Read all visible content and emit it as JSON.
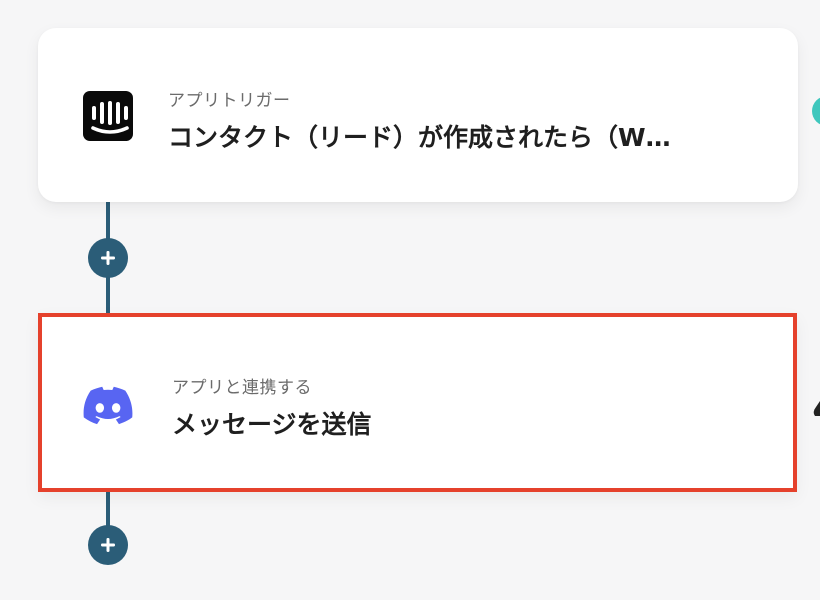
{
  "trigger_card": {
    "subtitle": "アプリトリガー",
    "title": "コンタクト（リード）が作成されたら（W…",
    "icon": "intercom-icon",
    "icon_color": "#0a0a0a"
  },
  "action_card": {
    "subtitle": "アプリと連携する",
    "title": "メッセージを送信",
    "icon": "discord-icon",
    "icon_color": "#5865f2",
    "highlight_color": "#e5412c"
  },
  "flow": {
    "connector_color": "#2b5d78",
    "add_step_icon": "plus-icon"
  }
}
